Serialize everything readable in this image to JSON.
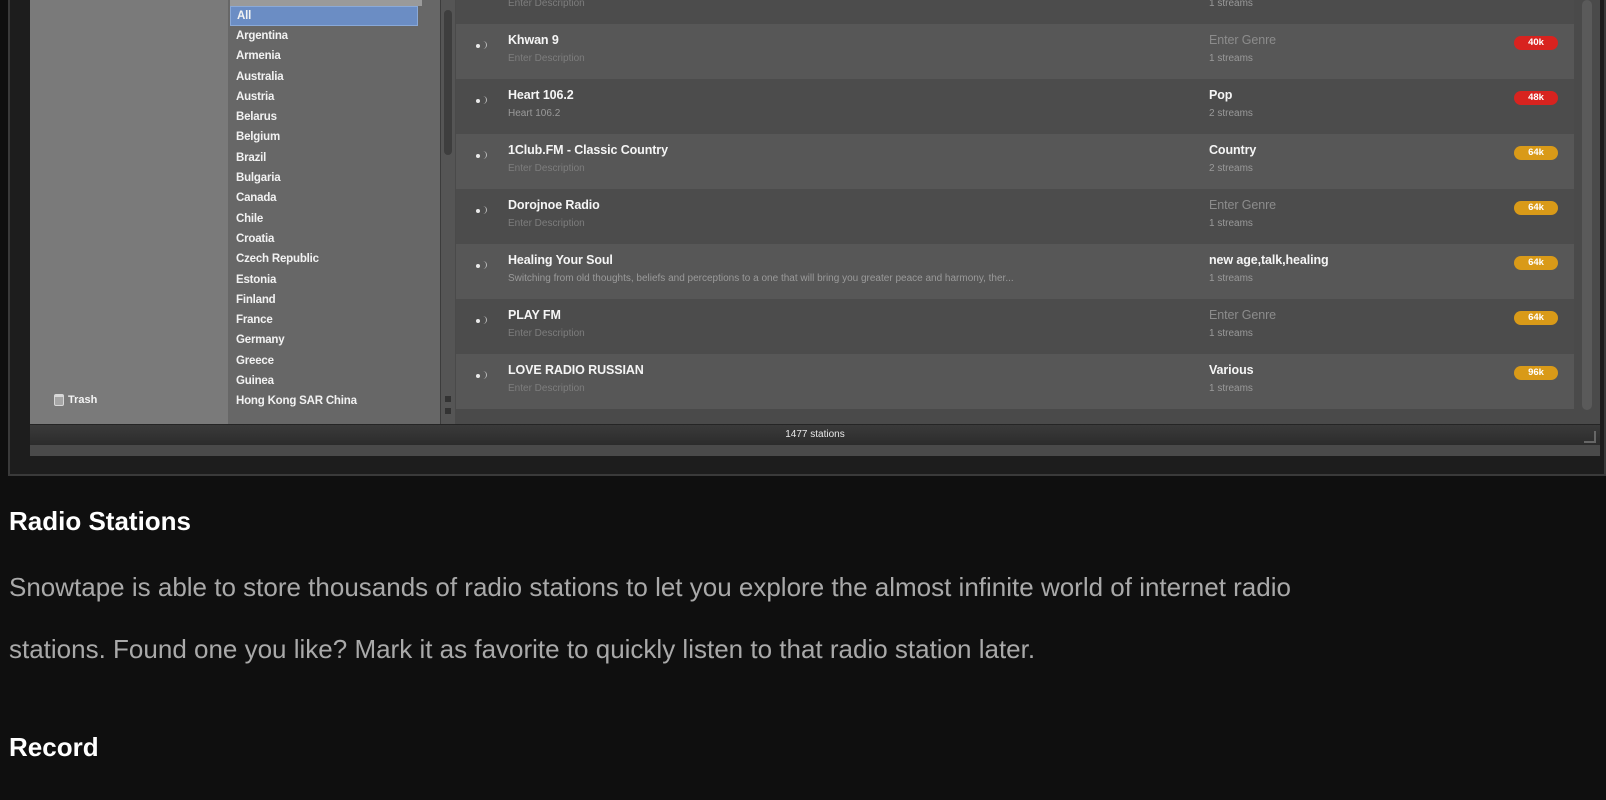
{
  "countries": {
    "items": [
      {
        "label": "All",
        "selected": true
      },
      {
        "label": "Argentina"
      },
      {
        "label": "Armenia"
      },
      {
        "label": "Australia"
      },
      {
        "label": "Austria"
      },
      {
        "label": "Belarus"
      },
      {
        "label": "Belgium"
      },
      {
        "label": "Brazil"
      },
      {
        "label": "Bulgaria"
      },
      {
        "label": "Canada"
      },
      {
        "label": "Chile"
      },
      {
        "label": "Croatia"
      },
      {
        "label": "Czech Republic"
      },
      {
        "label": "Estonia"
      },
      {
        "label": "Finland"
      },
      {
        "label": "France"
      },
      {
        "label": "Germany"
      },
      {
        "label": "Greece"
      },
      {
        "label": "Guinea"
      },
      {
        "label": "Hong Kong SAR China"
      }
    ]
  },
  "sidebar": {
    "trash_label": "Trash"
  },
  "stations": {
    "top_partial": {
      "desc": "Enter Description",
      "streams": "1 streams"
    },
    "rows": [
      {
        "name": "Khwan 9",
        "desc": "Enter Description",
        "desc_placeholder": true,
        "genre": "Enter Genre",
        "genre_placeholder": true,
        "streams": "1 streams",
        "bitrate": "40k",
        "badge_color": "#d8231f"
      },
      {
        "name": "Heart 106.2",
        "desc": "Heart 106.2",
        "desc_placeholder": false,
        "genre": "Pop",
        "genre_placeholder": false,
        "streams": "2 streams",
        "bitrate": "48k",
        "badge_color": "#d8231f"
      },
      {
        "name": "1Club.FM - Classic Country",
        "desc": "Enter Description",
        "desc_placeholder": true,
        "genre": "Country",
        "genre_placeholder": false,
        "streams": "2 streams",
        "bitrate": "64k",
        "badge_color": "#d99a18"
      },
      {
        "name": "Dorojnoe Radio",
        "desc": "Enter Description",
        "desc_placeholder": true,
        "genre": "Enter Genre",
        "genre_placeholder": true,
        "streams": "1 streams",
        "bitrate": "64k",
        "badge_color": "#d99a18"
      },
      {
        "name": "Healing Your Soul",
        "desc": "Switching from old thoughts, beliefs and perceptions to a one that will bring you greater peace and harmony, ther...",
        "desc_placeholder": false,
        "genre": "new age,talk,healing",
        "genre_placeholder": false,
        "streams": "1 streams",
        "bitrate": "64k",
        "badge_color": "#d99a18"
      },
      {
        "name": "PLAY FM",
        "desc": "Enter Description",
        "desc_placeholder": true,
        "genre": "Enter Genre",
        "genre_placeholder": true,
        "streams": "1 streams",
        "bitrate": "64k",
        "badge_color": "#d99a18"
      },
      {
        "name": "LOVE RADIO RUSSIAN",
        "desc": "Enter Description",
        "desc_placeholder": true,
        "genre": "Various",
        "genre_placeholder": false,
        "streams": "1 streams",
        "bitrate": "96k",
        "badge_color": "#d99a18"
      }
    ]
  },
  "status": {
    "count": "1477 stations"
  },
  "article": {
    "radio_heading": "Radio Stations",
    "radio_text_line1": "Snowtape is able to store thousands of radio stations to let you explore the almost infinite world of internet radio",
    "radio_text_line2": "stations. Found one you like? Mark it as favorite to quickly listen to that radio station later.",
    "record_heading": "Record"
  }
}
